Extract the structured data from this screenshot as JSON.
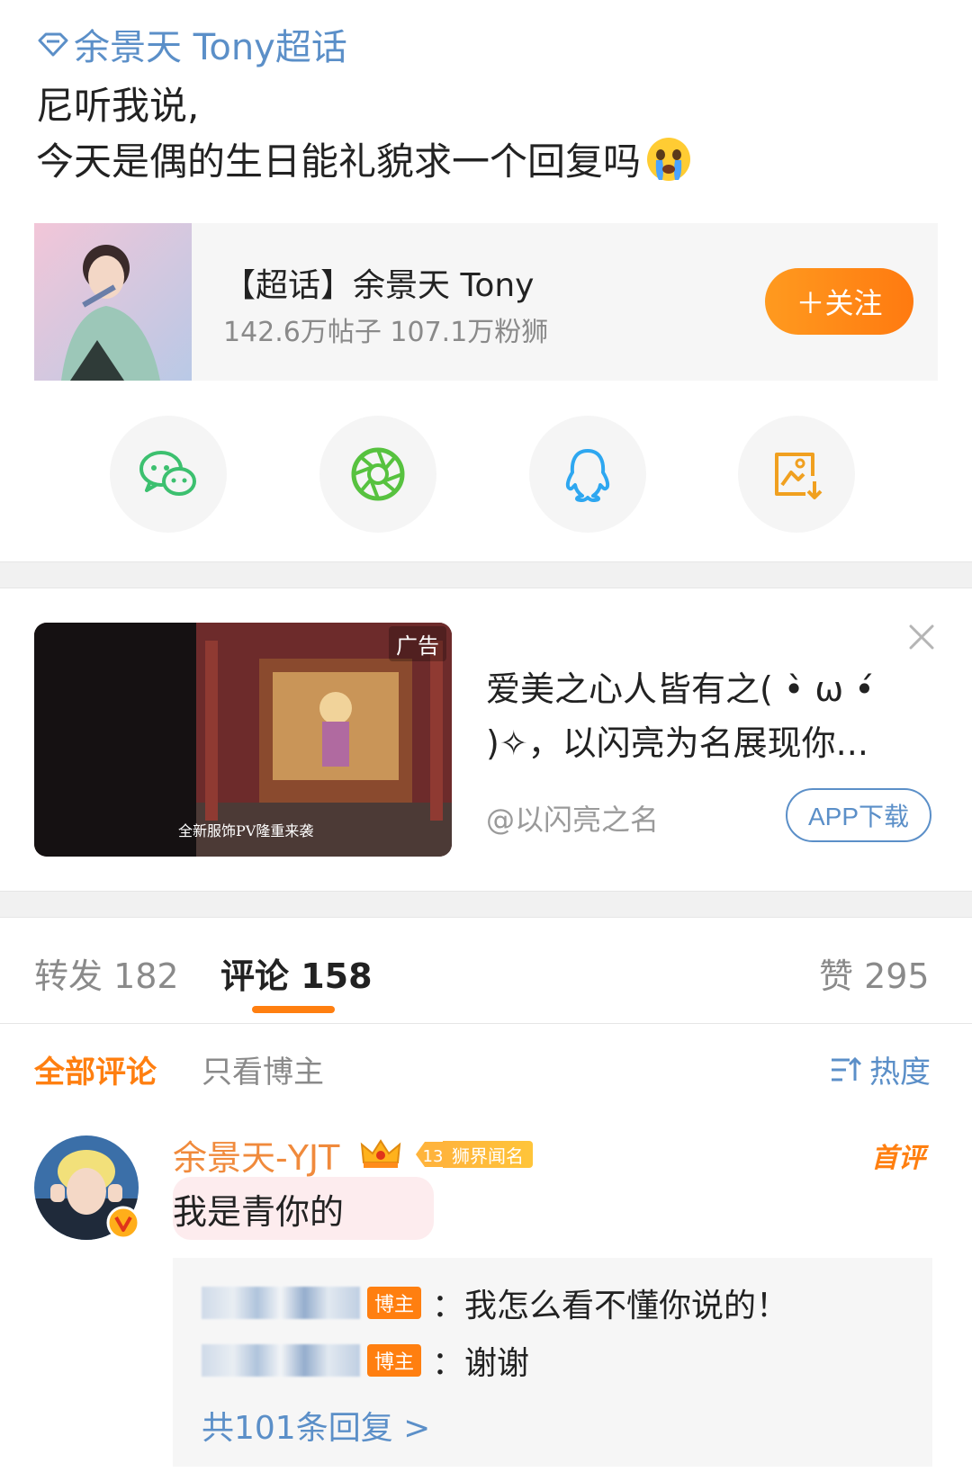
{
  "post": {
    "topic_link": "余景天 Tony超话",
    "line1": "尼听我说,",
    "line2": "今天是偶的生日能礼貌求一个回复吗",
    "emoji": "crying-face-icon"
  },
  "topic_card": {
    "name": "【超话】余景天 Tony",
    "stats": "142.6万帖子 107.1万粉狮",
    "follow_label": "＋关注"
  },
  "share": {
    "icons": [
      "wechat-icon",
      "moments-icon",
      "qq-icon",
      "save-image-icon"
    ]
  },
  "ad": {
    "image_tag": "广告",
    "image_caption": "全新服饰PV隆重来袭",
    "title": "爱美之心人皆有之( •̀ ω •́ )✧，以闪亮为名展现你...",
    "source": "@以闪亮之名",
    "button": "APP下载"
  },
  "tabs": {
    "repost": "转发 182",
    "comments": "评论 158",
    "likes": "赞 295"
  },
  "filters": {
    "all": "全部评论",
    "op_only": "只看博主",
    "sort": "热度"
  },
  "comment": {
    "user": "余景天-YJT",
    "fan_level": "13",
    "fan_title": "狮界闻名",
    "first_tag": "首评",
    "text": "我是青你的",
    "replies": [
      {
        "op_tag": "博主",
        "text": "：我怎么看不懂你说的！"
      },
      {
        "op_tag": "博主",
        "text": "：谢谢"
      }
    ],
    "more_replies": "共101条回复 >"
  },
  "colors": {
    "accent": "#ff7f10",
    "link": "#5b8fc8",
    "username": "#f08a3c"
  }
}
